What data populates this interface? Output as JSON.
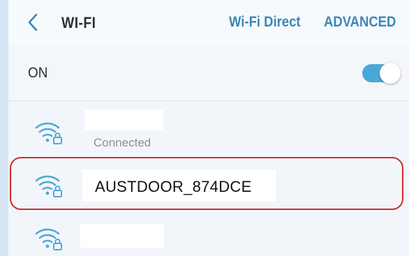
{
  "header": {
    "title": "WI-FI",
    "wifi_direct_label": "Wi-Fi Direct",
    "advanced_label": "ADVANCED",
    "back_icon": "chevron-left-icon"
  },
  "wifi_toggle": {
    "label": "ON",
    "state": "on",
    "color": "#4aa8d8"
  },
  "networks": [
    {
      "ssid": "",
      "status": "Connected",
      "icon": "wifi-secured-icon",
      "ssid_hidden": true
    },
    {
      "ssid": "AUSTDOOR_874DCE",
      "status": "",
      "icon": "wifi-secured-icon",
      "highlighted": true
    },
    {
      "ssid": "",
      "status": "",
      "icon": "wifi-secured-icon",
      "ssid_hidden": true
    }
  ],
  "colors": {
    "accent": "#3c86b8",
    "wifi_icon": "#52a9d6",
    "highlight_outline": "#d22a2f"
  }
}
